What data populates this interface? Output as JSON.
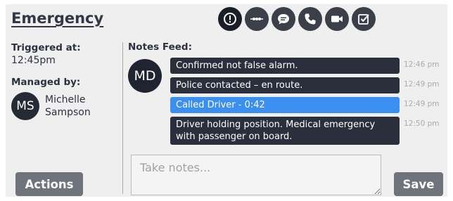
{
  "header": {
    "title": "Emergency",
    "icons": [
      "alert-icon",
      "ellipsis-icon",
      "chat-icon",
      "phone-icon",
      "video-icon",
      "checkbox-icon"
    ]
  },
  "sidebar": {
    "triggered_label": "Triggered at:",
    "triggered_value": "12:45pm",
    "managed_label": "Managed by:",
    "manager_initials": "MS",
    "manager_first": "Michelle",
    "manager_last": "Sampson",
    "actions_label": "Actions"
  },
  "notes": {
    "feed_label": "Notes Feed:",
    "author_initials": "MD",
    "messages": [
      {
        "text": "Confirmed not false alarm.",
        "time": "12:46 pm",
        "highlighted": false
      },
      {
        "text": "Police contacted – en route.",
        "time": "12:49 pm",
        "highlighted": false
      },
      {
        "text": "Called Driver - 0:42",
        "time": "12:49 pm",
        "highlighted": true
      },
      {
        "text": "Driver holding position. Medical emergency with passenger on board.",
        "time": "12:50 pm",
        "highlighted": false
      }
    ],
    "input_placeholder": "Take notes...",
    "save_label": "Save"
  },
  "colors": {
    "dark": "#2a2f3b",
    "highlight": "#3b8ff0",
    "button": "#6e737c"
  }
}
